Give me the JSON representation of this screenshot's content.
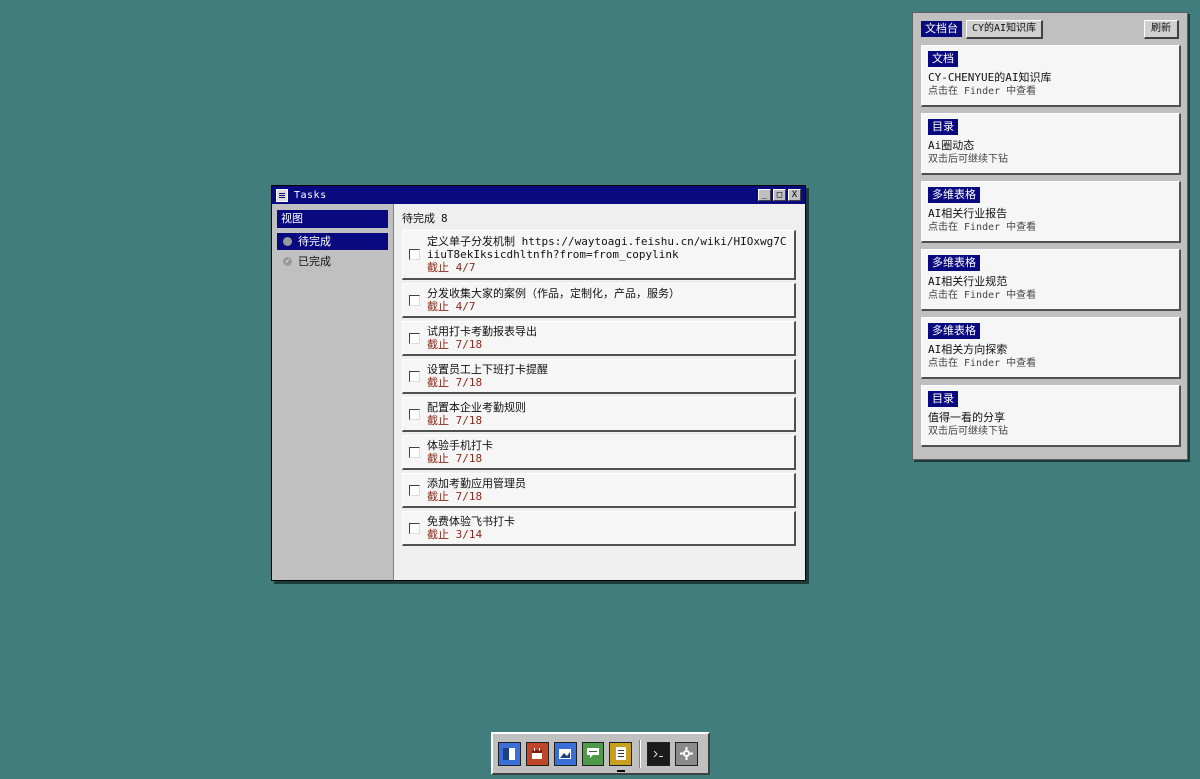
{
  "tasks_window": {
    "title": "Tasks",
    "buttons": {
      "minimize": "_",
      "maximize": "□",
      "close": "X"
    },
    "sidebar": {
      "header": "视图",
      "items": [
        {
          "label": "待完成",
          "selected": true
        },
        {
          "label": "已完成",
          "selected": false
        }
      ]
    },
    "main": {
      "heading": "待完成",
      "count": "8",
      "tasks": [
        {
          "title": "定义单子分发机制 https://waytoagi.feishu.cn/wiki/HIOxwg7CiiuT8ekIksicdhltnfh?from=from_copylink",
          "due": "截止 4/7"
        },
        {
          "title": "分发收集大家的案例（作品，定制化，产品，服务）",
          "due": "截止 4/7"
        },
        {
          "title": "试用打卡考勤报表导出",
          "due": "截止 7/18"
        },
        {
          "title": "设置员工上下班打卡提醒",
          "due": "截止 7/18"
        },
        {
          "title": "配置本企业考勤规则",
          "due": "截止 7/18"
        },
        {
          "title": "体验手机打卡",
          "due": "截止 7/18"
        },
        {
          "title": "添加考勤应用管理员",
          "due": "截止 7/18"
        },
        {
          "title": "免费体验飞书打卡",
          "due": "截止 3/14"
        }
      ]
    }
  },
  "docs_panel": {
    "tab_active": "文档台",
    "tab_other": "CY的AI知识库",
    "refresh": "刷新",
    "cards": [
      {
        "type": "文档",
        "name": "CY-CHENYUE的AI知识库",
        "hint": "点击在 Finder 中查看"
      },
      {
        "type": "目录",
        "name": "Ai圈动态",
        "hint": "双击后可继续下钻"
      },
      {
        "type": "多维表格",
        "name": "AI相关行业报告",
        "hint": "点击在 Finder 中查看"
      },
      {
        "type": "多维表格",
        "name": "AI相关行业规范",
        "hint": "点击在 Finder 中查看"
      },
      {
        "type": "多维表格",
        "name": "AI相关方向探索",
        "hint": "点击在 Finder 中查看"
      },
      {
        "type": "目录",
        "name": "值得一看的分享",
        "hint": "双击后可继续下钻"
      }
    ]
  },
  "dock": {
    "icons": [
      {
        "name": "finder-icon",
        "color": "#3b6fd8"
      },
      {
        "name": "calendar-icon",
        "color": "#c0462a"
      },
      {
        "name": "photos-icon",
        "color": "#3b6fd8"
      },
      {
        "name": "chat-icon",
        "color": "#4f9a4a"
      },
      {
        "name": "notes-icon",
        "color": "#c8a020"
      },
      {
        "name": "terminal-icon",
        "color": "#1a1a1a"
      },
      {
        "name": "settings-icon",
        "color": "#8a8a8a"
      }
    ]
  }
}
